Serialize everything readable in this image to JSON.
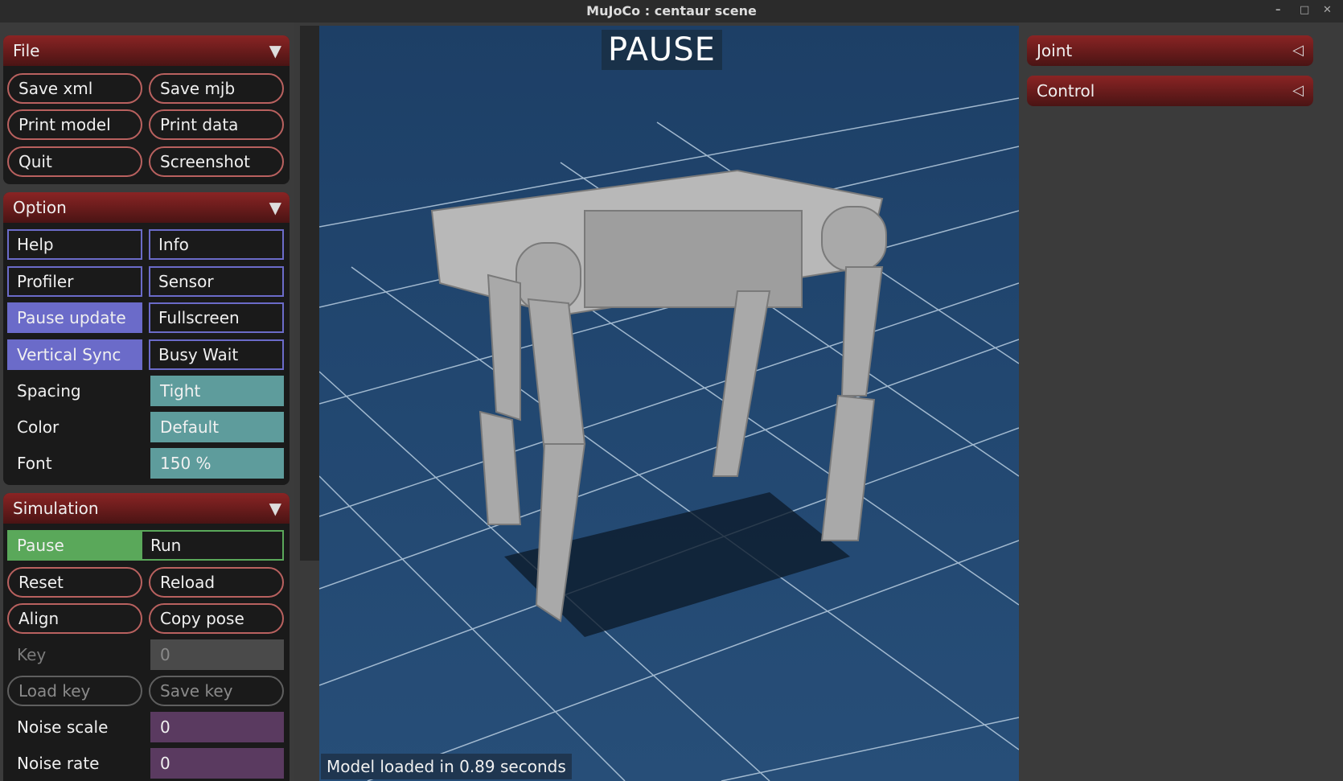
{
  "window": {
    "title": "MuJoCo : centaur scene",
    "controls": [
      "–",
      "□",
      "✕"
    ]
  },
  "file": {
    "title": "File",
    "buttons": [
      "Save xml",
      "Save mjb",
      "Print model",
      "Print data",
      "Quit",
      "Screenshot"
    ]
  },
  "option": {
    "title": "Option",
    "checkboxes": [
      {
        "label": "Help",
        "checked": false
      },
      {
        "label": "Info",
        "checked": false
      },
      {
        "label": "Profiler",
        "checked": false
      },
      {
        "label": "Sensor",
        "checked": false
      },
      {
        "label": "Pause update",
        "checked": true
      },
      {
        "label": "Fullscreen",
        "checked": false
      },
      {
        "label": "Vertical Sync",
        "checked": true
      },
      {
        "label": "Busy Wait",
        "checked": false
      }
    ],
    "spacing": {
      "label": "Spacing",
      "value": "Tight"
    },
    "color": {
      "label": "Color",
      "value": "Default"
    },
    "font": {
      "label": "Font",
      "value": "150 %"
    }
  },
  "simulation": {
    "title": "Simulation",
    "run_mode": {
      "options": [
        "Pause",
        "Run"
      ],
      "selected": "Pause"
    },
    "buttons": [
      "Reset",
      "Reload",
      "Align",
      "Copy pose"
    ],
    "key": {
      "label": "Key",
      "value": "0"
    },
    "key_buttons": [
      "Load key",
      "Save key"
    ],
    "noise_scale": {
      "label": "Noise scale",
      "value": "0"
    },
    "noise_rate": {
      "label": "Noise rate",
      "value": "0"
    }
  },
  "viewport": {
    "overlay_title": "PAUSE",
    "status": "Model loaded in 0.89 seconds"
  },
  "right": {
    "joint": "Joint",
    "control": "Control"
  },
  "colors": {
    "header_red": "#8a2424",
    "button_border": "#b9615f",
    "checkbox": "#6b6bc9",
    "select": "#5e9c9c",
    "radio": "#5aa85a",
    "numeric": "#5a3a60"
  }
}
